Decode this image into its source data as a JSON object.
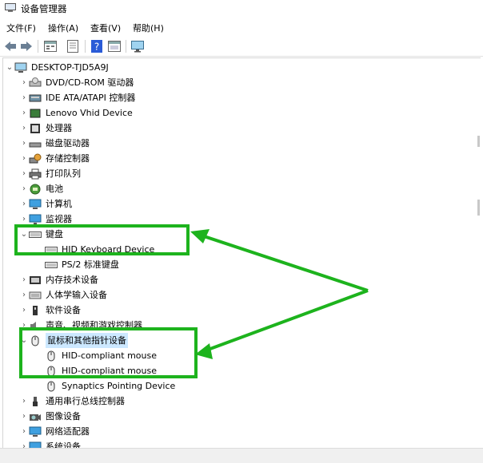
{
  "window": {
    "title": "设备管理器"
  },
  "menu": [
    {
      "label": "文件(F)"
    },
    {
      "label": "操作(A)"
    },
    {
      "label": "查看(V)"
    },
    {
      "label": "帮助(H)"
    }
  ],
  "toolbar": {
    "buttons": [
      "back-arrow-icon",
      "forward-arrow-icon",
      "properties-icon",
      "list-icon",
      "help-icon",
      "view-icon",
      "monitor-icon"
    ]
  },
  "tree": {
    "root": {
      "label": "DESKTOP-TJD5A9J",
      "icon": "computer-icon"
    },
    "items": [
      {
        "label": "DVD/CD-ROM 驱动器",
        "icon": "disc-drive-icon",
        "expanded": false
      },
      {
        "label": "IDE ATA/ATAPI 控制器",
        "icon": "ide-controller-icon",
        "expanded": false
      },
      {
        "label": "Lenovo Vhid Device",
        "icon": "device-icon",
        "expanded": false
      },
      {
        "label": "处理器",
        "icon": "processor-icon",
        "expanded": false
      },
      {
        "label": "磁盘驱动器",
        "icon": "disk-icon",
        "expanded": false
      },
      {
        "label": "存储控制器",
        "icon": "storage-controller-icon",
        "expanded": false
      },
      {
        "label": "打印队列",
        "icon": "printer-icon",
        "expanded": false
      },
      {
        "label": "电池",
        "icon": "battery-icon",
        "expanded": false
      },
      {
        "label": "计算机",
        "icon": "computer-icon",
        "expanded": false
      },
      {
        "label": "监视器",
        "icon": "monitor-icon",
        "expanded": false
      },
      {
        "label": "键盘",
        "icon": "keyboard-icon",
        "expanded": true,
        "children": [
          {
            "label": "HID Keyboard Device",
            "icon": "keyboard-icon"
          },
          {
            "label": "PS/2 标准键盘",
            "icon": "keyboard-icon"
          }
        ]
      },
      {
        "label": "内存技术设备",
        "icon": "memory-icon",
        "expanded": false
      },
      {
        "label": "人体学输入设备",
        "icon": "hid-icon",
        "expanded": false
      },
      {
        "label": "软件设备",
        "icon": "software-device-icon",
        "expanded": false
      },
      {
        "label": "声音、视频和游戏控制器",
        "icon": "sound-icon",
        "expanded": false
      },
      {
        "label": "鼠标和其他指针设备",
        "icon": "mouse-icon",
        "expanded": true,
        "selected": true,
        "children": [
          {
            "label": "HID-compliant mouse",
            "icon": "mouse-icon"
          },
          {
            "label": "HID-compliant mouse",
            "icon": "mouse-icon"
          },
          {
            "label": "Synaptics Pointing Device",
            "icon": "mouse-icon"
          }
        ]
      },
      {
        "label": "通用串行总线控制器",
        "icon": "usb-icon",
        "expanded": false
      },
      {
        "label": "图像设备",
        "icon": "camera-icon",
        "expanded": false
      },
      {
        "label": "网络适配器",
        "icon": "network-icon",
        "expanded": false
      },
      {
        "label": "系统设备",
        "icon": "system-device-icon",
        "expanded": false
      }
    ]
  },
  "colors": {
    "annotation": "#1db31d",
    "selection": "#cce8ff"
  }
}
